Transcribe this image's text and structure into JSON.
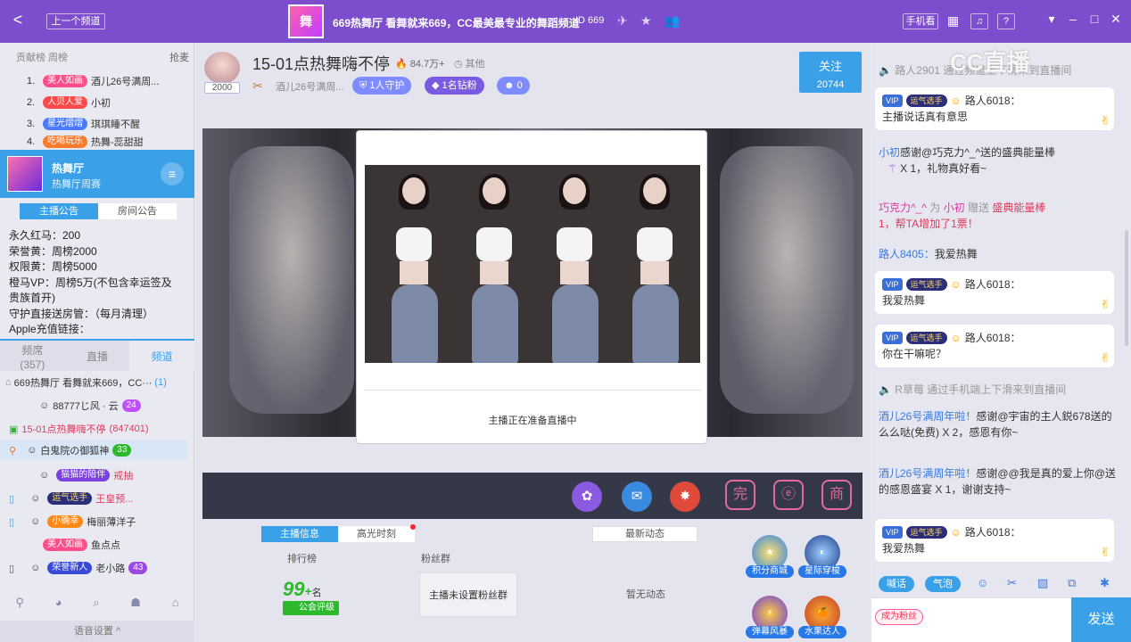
{
  "topbar": {
    "back": "<",
    "prev_channel": "上一个频道",
    "logo_text": "舞",
    "title": "669热舞厅  看舞就来669，CC最美最专业的舞蹈频道",
    "id_label": "ID 669",
    "phone_btn": "手机看",
    "colors": {
      "bg": "#7c4dcc"
    }
  },
  "left": {
    "rank_head": "贡献榜 周榜",
    "grab": "抢麦",
    "rank": [
      {
        "num": "1.",
        "badge": "美人如画",
        "badge_color": "#ff4f8a",
        "name": "酒儿26号满周..."
      },
      {
        "num": "2.",
        "badge": "人贝人爱",
        "badge_color": "#ff4a4a",
        "name": "小初"
      },
      {
        "num": "3.",
        "badge": "星光熠熠",
        "badge_color": "#4a7aff",
        "name": "琪琪睡不醒"
      },
      {
        "num": "4.",
        "badge": "吃喝玩乐",
        "badge_color": "#ff7a2a",
        "name": "热舞-蕊甜甜"
      }
    ],
    "channel_card": {
      "name": "热舞厅",
      "sub": "热舞厅周赛"
    },
    "notice_tabs": [
      "主播公告",
      "房间公告"
    ],
    "notice_lines": [
      "永久红马：200",
      "荣誉黄：周榜2000",
      "权限黄：周榜5000",
      "橙马VP：周榜5万(不包含幸运签及",
      "贵族首开)",
      "守护直接送房管：（每月清理）",
      "Apple充值链接："
    ],
    "chan_tabs": [
      {
        "label": "频席",
        "count": "(357)"
      },
      {
        "label": "直播",
        "count": ""
      },
      {
        "label": "频道",
        "count": ""
      }
    ],
    "channel_list": [
      {
        "text": "669热舞厅  看舞就来669，CC···",
        "extra": "(1)"
      },
      {
        "text": "88777じ风 · 云",
        "extra": "24"
      },
      {
        "text": "15-01点热舞嗨不停",
        "extra": "(847401)"
      },
      {
        "text": "白鬼院の御狐神",
        "extra": "33"
      },
      {
        "text": "",
        "badge": "猫猫的陪伴",
        "extra": "戒抽"
      },
      {
        "text": "",
        "badge": "运气选手",
        "extra": "王皇预..."
      },
      {
        "text": "梅丽薄洋子",
        "badge": "小确幸"
      },
      {
        "text": "鱼点点",
        "badge": "美人如画"
      },
      {
        "text": "老小路",
        "badge": "荣誉新人",
        "extra": "43"
      }
    ],
    "voice_settings": "语音设置 ^"
  },
  "room": {
    "fans_count": "2000",
    "title": "15-01点热舞嗨不停",
    "hot": "84.7万+",
    "more": "其他",
    "sub": "酒儿26号满周...",
    "guard": "1人守护",
    "diamond": "1名钻粉",
    "viewers": "0",
    "follow_label": "关注",
    "follow_count": "20744",
    "popup_text": "主播正在准备直播中",
    "info_tabs": [
      "主播信息",
      "高光时刻"
    ],
    "latest": "最新动态",
    "rank_label": "排行榜",
    "fans_group_label": "粉丝群",
    "rank_value": "99",
    "rank_plus": "+",
    "rank_unit": "名",
    "guild_rating": "公会评级",
    "fans_group_empty": "主播未设置粉丝群",
    "no_news": "暂无动态",
    "side_apps": [
      "积分商城",
      "星际穿梭",
      "弹幕风暴",
      "水果达人"
    ]
  },
  "chat": {
    "logo": "CC直播",
    "sys1": "路人2901 通过频道上下滑来到直播间",
    "bubbles": [
      {
        "vip": "VIP",
        "luck": "运气选手",
        "name": "路人6018：",
        "text": "主播说话真有意思"
      },
      {
        "vip": "VIP",
        "luck": "运气选手",
        "name": "路人6018：",
        "text": "我爱热舞"
      },
      {
        "vip": "VIP",
        "luck": "运气选手",
        "name": "路人6018：",
        "text": "你在干嘛呢？"
      },
      {
        "vip": "VIP",
        "luck": "运气选手",
        "name": "路人6018：",
        "text": "我爱热舞"
      }
    ],
    "gift1_user": "小初",
    "gift1_thanks": "感谢@巧克力^_^送的盛典能量棒",
    "gift1_count": "X 1，礼物真好看~",
    "vote_user": "巧克力^_^",
    "vote_for": "为",
    "vote_target": "小初",
    "vote_give": "赠送",
    "vote_gift": "盛典能量棒",
    "vote_rest": "1，帮TA增加了1票！",
    "msg_user": "路人8405：",
    "msg_text": "我爱热舞",
    "sys2": "R草莓 通过手机端上下滑来到直播间",
    "gift2_user": "酒儿26号满周年啦！",
    "gift2_thanks": "感谢@宇宙的主人鋭678送的么么哒(免费)",
    "gift2_count": "X 2，感恩有你~",
    "gift3_user": "酒儿26号满周年啦！",
    "gift3_thanks": "感谢@@我是真的爱上你@送的感恩盛宴",
    "gift3_count": "X 1，谢谢支持~",
    "tool_shout": "喊话",
    "tool_bubble": "气泡",
    "become_fan": "成为粉丝",
    "send": "发送"
  }
}
